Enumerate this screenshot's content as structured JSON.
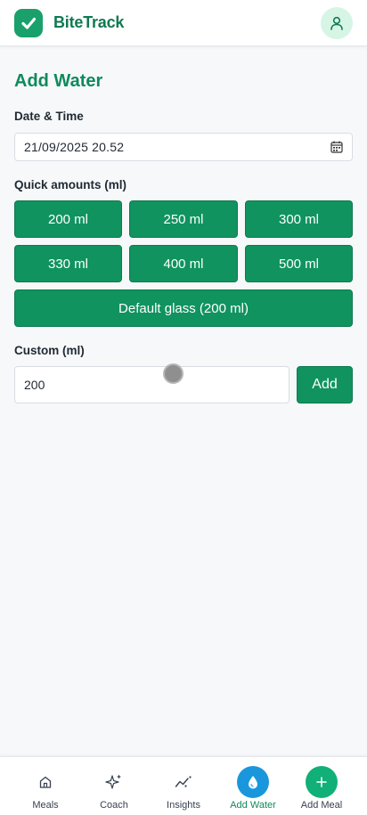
{
  "app": {
    "name": "BiteTrack",
    "brand_color": "#0f7a52",
    "accent_color": "#10935f"
  },
  "header": {
    "logo_icon": "check-shield-icon",
    "profile_icon": "user-icon"
  },
  "page": {
    "title": "Add Water"
  },
  "datetime": {
    "label": "Date & Time",
    "value": "21/09/2025  20.52",
    "icon": "calendar-icon"
  },
  "quick": {
    "label": "Quick amounts (ml)",
    "amounts": [
      "200 ml",
      "250 ml",
      "300 ml",
      "330 ml",
      "400 ml",
      "500 ml"
    ],
    "default_label": "Default glass (200 ml)"
  },
  "custom": {
    "label": "Custom (ml)",
    "value": "200",
    "add_label": "Add"
  },
  "nav": {
    "items": [
      {
        "label": "Meals",
        "icon": "home-icon"
      },
      {
        "label": "Coach",
        "icon": "sparkles-icon"
      },
      {
        "label": "Insights",
        "icon": "trend-icon"
      },
      {
        "label": "Add Water",
        "icon": "water-drop-icon",
        "active": true
      },
      {
        "label": "Add Meal",
        "icon": "plus-icon"
      }
    ]
  }
}
